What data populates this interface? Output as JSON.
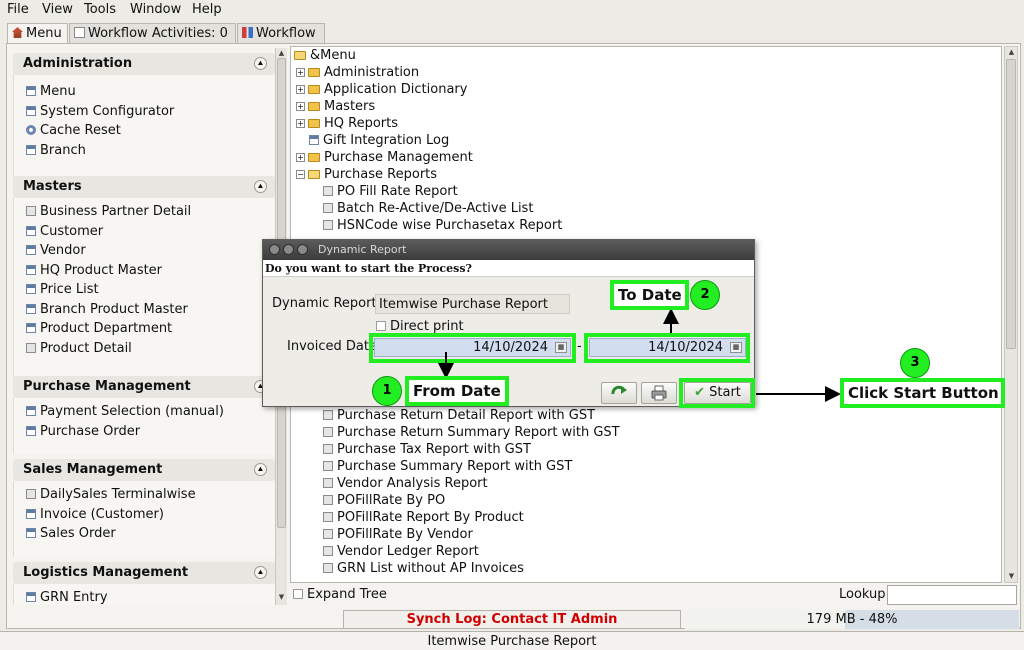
{
  "menubar": {
    "items": [
      {
        "label": "File"
      },
      {
        "label": "View"
      },
      {
        "label": "Tools"
      },
      {
        "label": "Window"
      },
      {
        "label": "Help"
      }
    ]
  },
  "tabs": [
    {
      "label": "Menu",
      "icon": "home-icon"
    },
    {
      "label": "Workflow Activities: 0",
      "icon": "document-icon"
    },
    {
      "label": "Workflow",
      "icon": "workflow-icon"
    }
  ],
  "sidebar": {
    "groups": [
      {
        "title": "Administration",
        "items": [
          {
            "label": "Menu",
            "icon": "window-icon"
          },
          {
            "label": "System Configurator",
            "icon": "window-icon"
          },
          {
            "label": "Cache Reset",
            "icon": "gear-icon"
          },
          {
            "label": "Branch",
            "icon": "window-icon"
          }
        ]
      },
      {
        "title": "Masters",
        "items": [
          {
            "label": "Business Partner Detail",
            "icon": "report-icon"
          },
          {
            "label": "Customer",
            "icon": "window-icon"
          },
          {
            "label": "Vendor",
            "icon": "window-icon"
          },
          {
            "label": "HQ Product Master",
            "icon": "window-icon"
          },
          {
            "label": "Price List",
            "icon": "window-icon"
          },
          {
            "label": "Branch Product Master",
            "icon": "window-icon"
          },
          {
            "label": "Product Department",
            "icon": "window-icon"
          },
          {
            "label": "Product Detail",
            "icon": "report-icon"
          }
        ]
      },
      {
        "title": "Purchase Management",
        "items": [
          {
            "label": "Payment Selection (manual)",
            "icon": "window-icon"
          },
          {
            "label": "Purchase Order",
            "icon": "window-icon"
          }
        ]
      },
      {
        "title": "Sales Management",
        "items": [
          {
            "label": "DailySales Terminalwise",
            "icon": "report-icon"
          },
          {
            "label": "Invoice (Customer)",
            "icon": "window-icon"
          },
          {
            "label": "Sales Order",
            "icon": "window-icon"
          }
        ]
      },
      {
        "title": "Logistics Management",
        "items": [
          {
            "label": "GRN Entry",
            "icon": "window-icon"
          }
        ]
      }
    ]
  },
  "tree": {
    "root": "&Menu",
    "nodes": [
      {
        "label": "Administration",
        "kind": "folder"
      },
      {
        "label": "Application Dictionary",
        "kind": "folder"
      },
      {
        "label": "Masters",
        "kind": "folder"
      },
      {
        "label": "HQ Reports",
        "kind": "folder"
      },
      {
        "label": "Gift Integration Log",
        "kind": "window"
      },
      {
        "label": "Purchase Management",
        "kind": "folder"
      },
      {
        "label": "Purchase Reports",
        "kind": "folder-open"
      },
      {
        "label": "PO Fill Rate Report",
        "kind": "report"
      },
      {
        "label": "Batch Re-Active/De-Active List",
        "kind": "report"
      },
      {
        "label": "HSNCode wise Purchasetax Report",
        "kind": "report"
      },
      {
        "label": "Purchase Return Detail Report with GST",
        "kind": "report"
      },
      {
        "label": "Purchase Return Summary Report with GST",
        "kind": "report"
      },
      {
        "label": "Purchase Tax Report with GST",
        "kind": "report"
      },
      {
        "label": "Purchase Summary Report with GST",
        "kind": "report"
      },
      {
        "label": "Vendor Analysis Report",
        "kind": "report"
      },
      {
        "label": "POFillRate By PO",
        "kind": "report"
      },
      {
        "label": "POFillRate Report By Product",
        "kind": "report"
      },
      {
        "label": "POFillRate By Vendor",
        "kind": "report"
      },
      {
        "label": "Vendor Ledger Report",
        "kind": "report"
      },
      {
        "label": "GRN List without AP Invoices",
        "kind": "report"
      }
    ]
  },
  "footer": {
    "expand_tree_label": "Expand Tree",
    "lookup_label": "Lookup",
    "lookup_value": "",
    "synch_log": "Synch Log: Contact IT Admin",
    "memory": "179 MB - 48%",
    "memory_fraction": 0.48,
    "status": "Itemwise Purchase Report"
  },
  "dialog": {
    "title": "Dynamic Report",
    "question": "Do you want to start the Process?",
    "report_label": "Dynamic Report",
    "report_value": "Itemwise Purchase Report",
    "direct_print_label": "Direct print",
    "invoiced_date_label": "Invoiced Date",
    "from_date": "14/10/2024",
    "to_date": "14/10/2024",
    "range_separator": "-",
    "start_label": "Start"
  },
  "annotations": {
    "from_date": {
      "number": "1",
      "text": "From Date"
    },
    "to_date": {
      "number": "2",
      "text": "To Date"
    },
    "start": {
      "number": "3",
      "text": "Click Start Button"
    },
    "color": "#20ee20"
  }
}
